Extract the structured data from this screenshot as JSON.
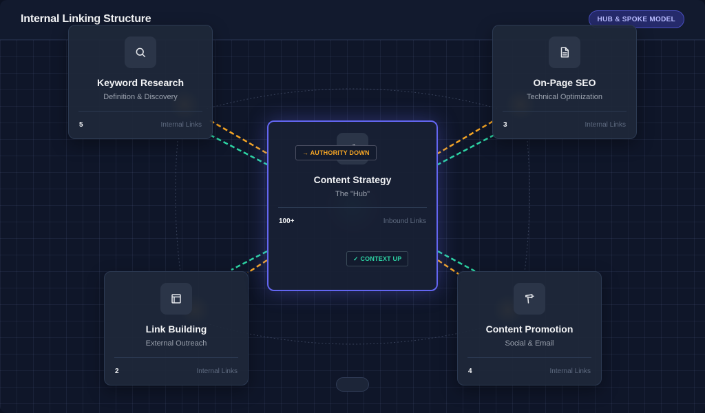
{
  "header": {
    "title": "Internal Linking Structure",
    "badge": "HUB & SPOKE MODEL"
  },
  "hub": {
    "title": "Content Strategy",
    "subtitle": "The \"Hub\"",
    "count": "100+",
    "count_label": "Inbound Links",
    "icon": "megaphone-icon"
  },
  "tags": {
    "authority_arrow": "→",
    "authority": "AUTHORITY DOWN",
    "context_check": "✓",
    "context": "CONTEXT UP"
  },
  "spokes": [
    {
      "title": "Keyword Research",
      "subtitle": "Definition & Discovery",
      "count": "5",
      "count_label": "Internal Links",
      "icon": "search-icon"
    },
    {
      "title": "On-Page SEO",
      "subtitle": "Technical Optimization",
      "count": "3",
      "count_label": "Internal Links",
      "icon": "document-icon"
    },
    {
      "title": "Link Building",
      "subtitle": "External Outreach",
      "count": "2",
      "count_label": "Internal Links",
      "icon": "frame-icon"
    },
    {
      "title": "Content Promotion",
      "subtitle": "Social & Email",
      "count": "4",
      "count_label": "Internal Links",
      "icon": "megaphone-icon"
    }
  ],
  "colors": {
    "authority": "#f5a524",
    "context": "#2dd4a4",
    "hub_border": "#6366f1",
    "background": "#0f1629"
  }
}
